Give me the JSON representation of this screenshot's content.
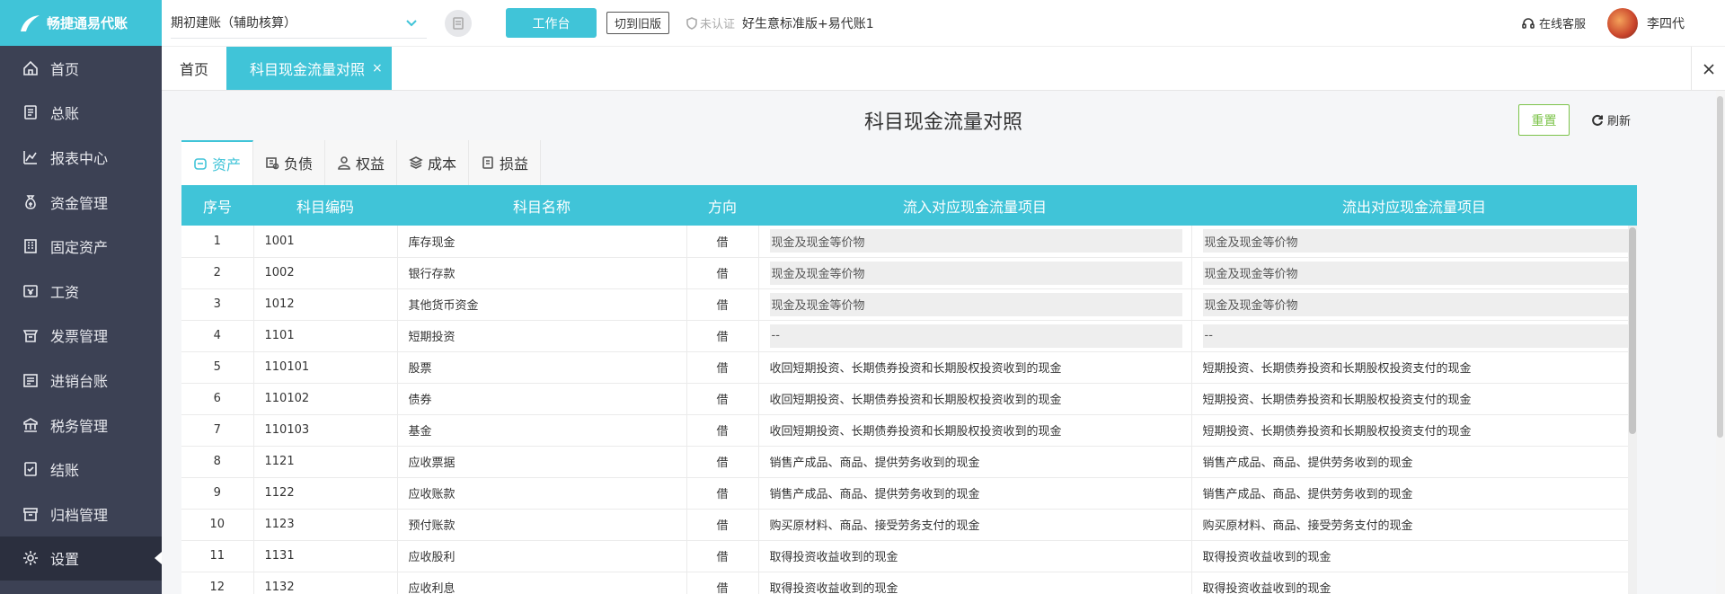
{
  "app": {
    "logo_text": "畅捷通易代账"
  },
  "sidebar": {
    "items": [
      {
        "label": "首页",
        "icon": "home-icon"
      },
      {
        "label": "总账",
        "icon": "ledger-icon"
      },
      {
        "label": "报表中心",
        "icon": "chart-icon"
      },
      {
        "label": "资金管理",
        "icon": "money-bag-icon"
      },
      {
        "label": "固定资产",
        "icon": "building-icon"
      },
      {
        "label": "工资",
        "icon": "salary-icon"
      },
      {
        "label": "发票管理",
        "icon": "invoice-icon"
      },
      {
        "label": "进销台账",
        "icon": "inventory-icon"
      },
      {
        "label": "税务管理",
        "icon": "tax-icon"
      },
      {
        "label": "结账",
        "icon": "checkout-icon"
      },
      {
        "label": "归档管理",
        "icon": "archive-icon"
      },
      {
        "label": "设置",
        "icon": "gear-icon"
      }
    ],
    "active_index": 11
  },
  "topbar": {
    "period_select": "期初建账（辅助核算）",
    "workbench_label": "工作台",
    "switch_old_label": "切到旧版",
    "cert_label": "未认证",
    "edition": "好生意标准版+易代账1",
    "service_label": "在线客服",
    "username": "李四代"
  },
  "page_tabs": [
    {
      "label": "首页"
    },
    {
      "label": "科目现金流量对照",
      "close": "×"
    }
  ],
  "page": {
    "title": "科目现金流量对照",
    "reset_label": "重置",
    "refresh_label": "刷新"
  },
  "category_tabs": [
    {
      "label": "资产",
      "icon": "asset-icon"
    },
    {
      "label": "负债",
      "icon": "liability-icon"
    },
    {
      "label": "权益",
      "icon": "equity-icon"
    },
    {
      "label": "成本",
      "icon": "cost-icon"
    },
    {
      "label": "损益",
      "icon": "profit-loss-icon"
    }
  ],
  "table": {
    "columns": [
      "序号",
      "科目编码",
      "科目名称",
      "方向",
      "流入对应现金流量项目",
      "流出对应现金流量项目"
    ],
    "rows": [
      {
        "no": "1",
        "code": "1001",
        "name": "库存现金",
        "dir": "借",
        "in": "现金及现金等价物",
        "out": "现金及现金等价物",
        "boxed": true
      },
      {
        "no": "2",
        "code": "1002",
        "name": "银行存款",
        "dir": "借",
        "in": "现金及现金等价物",
        "out": "现金及现金等价物",
        "boxed": true
      },
      {
        "no": "3",
        "code": "1012",
        "name": "其他货币资金",
        "dir": "借",
        "in": "现金及现金等价物",
        "out": "现金及现金等价物",
        "boxed": true
      },
      {
        "no": "4",
        "code": "1101",
        "name": "短期投资",
        "dir": "借",
        "in": "--",
        "out": "--",
        "boxed": true
      },
      {
        "no": "5",
        "code": "110101",
        "name": "股票",
        "dir": "借",
        "in": "收回短期投资、长期债券投资和长期股权投资收到的现金",
        "out": "短期投资、长期债券投资和长期股权投资支付的现金",
        "boxed": false
      },
      {
        "no": "6",
        "code": "110102",
        "name": "债券",
        "dir": "借",
        "in": "收回短期投资、长期债券投资和长期股权投资收到的现金",
        "out": "短期投资、长期债券投资和长期股权投资支付的现金",
        "boxed": false
      },
      {
        "no": "7",
        "code": "110103",
        "name": "基金",
        "dir": "借",
        "in": "收回短期投资、长期债券投资和长期股权投资收到的现金",
        "out": "短期投资、长期债券投资和长期股权投资支付的现金",
        "boxed": false
      },
      {
        "no": "8",
        "code": "1121",
        "name": "应收票据",
        "dir": "借",
        "in": "销售产成品、商品、提供劳务收到的现金",
        "out": "销售产成品、商品、提供劳务收到的现金",
        "boxed": false
      },
      {
        "no": "9",
        "code": "1122",
        "name": "应收账款",
        "dir": "借",
        "in": "销售产成品、商品、提供劳务收到的现金",
        "out": "销售产成品、商品、提供劳务收到的现金",
        "boxed": false
      },
      {
        "no": "10",
        "code": "1123",
        "name": "预付账款",
        "dir": "借",
        "in": "购买原材料、商品、接受劳务支付的现金",
        "out": "购买原材料、商品、接受劳务支付的现金",
        "boxed": false
      },
      {
        "no": "11",
        "code": "1131",
        "name": "应收股利",
        "dir": "借",
        "in": "取得投资收益收到的现金",
        "out": "取得投资收益收到的现金",
        "boxed": false
      },
      {
        "no": "12",
        "code": "1132",
        "name": "应收利息",
        "dir": "借",
        "in": "取得投资收益收到的现金",
        "out": "取得投资收益收到的现金",
        "boxed": false
      }
    ]
  },
  "colors": {
    "accent": "#40c4d8",
    "sidebar_bg": "#3c4154",
    "reset_green": "#7cc34a"
  }
}
